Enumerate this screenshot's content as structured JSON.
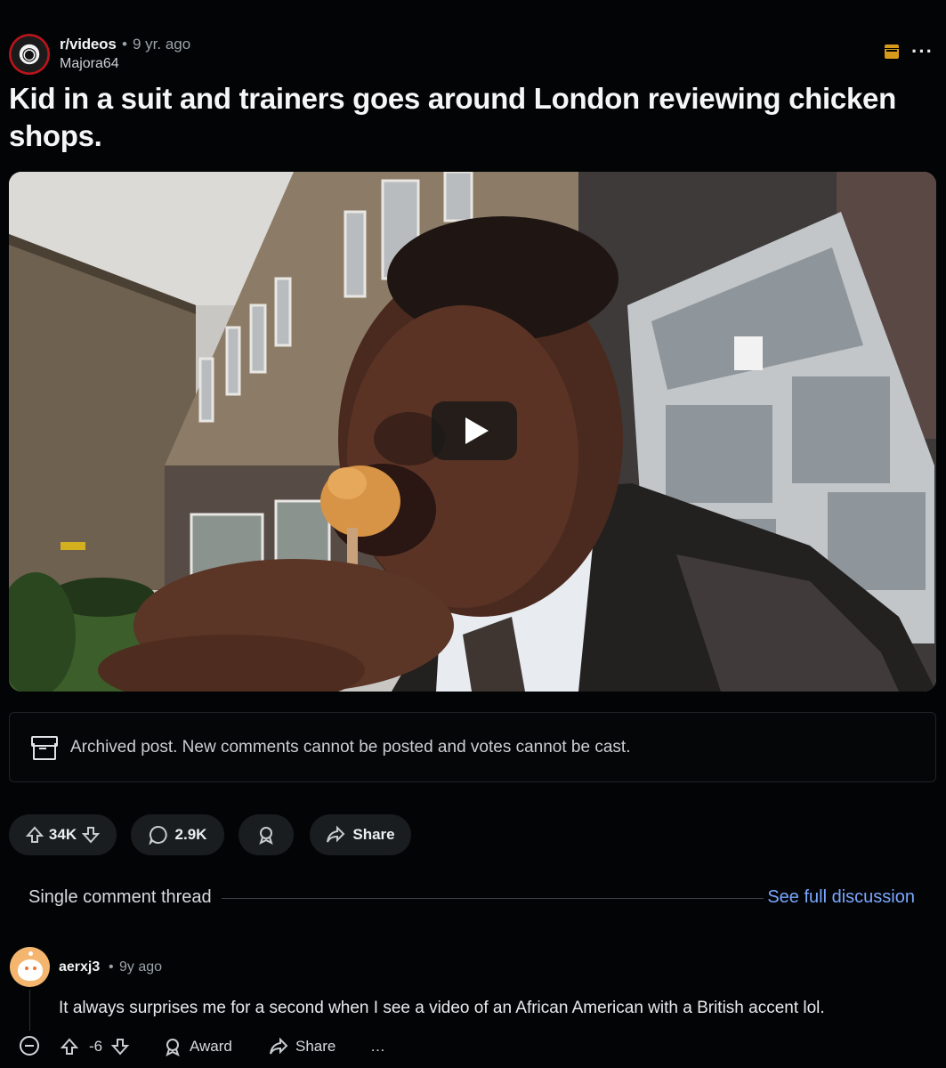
{
  "post": {
    "subreddit": "r/videos",
    "separator": "•",
    "time": "9 yr. ago",
    "author": "Majora64",
    "title": "Kid in a suit and trainers goes around London reviewing chicken shops.",
    "more_icon": "more-horizontal-icon",
    "archived_badge_icon": "archive-badge-icon"
  },
  "video": {
    "play_icon": "play-icon"
  },
  "archived_notice": {
    "text": "Archived post. New comments cannot be posted and votes cannot be cast."
  },
  "actions": {
    "votes": "34K",
    "comments": "2.9K",
    "share": "Share"
  },
  "thread": {
    "label": "Single comment thread",
    "see_full": "See full discussion"
  },
  "comment": {
    "author": "aerxj3",
    "separator": "•",
    "time": "9y ago",
    "body": "It always surprises me for a second when I see a video of an African American with a British accent lol.",
    "score": "-6",
    "award": "Award",
    "share": "Share",
    "more": "…"
  },
  "colors": {
    "background": "#030405",
    "link_blue": "#7aa7ff",
    "archive_gold": "#d89a1a",
    "pill_bg": "#1a1d20"
  }
}
